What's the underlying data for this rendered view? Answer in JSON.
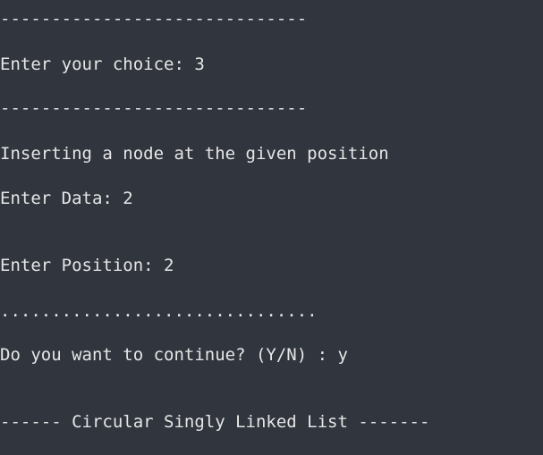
{
  "terminal": {
    "lines": [
      "------------------------------",
      "Enter your choice: 3",
      "------------------------------",
      "Inserting a node at the given position",
      "Enter Data: 2",
      "Enter Position: 2",
      "...............................",
      "Do you want to continue? (Y/N) : y",
      "------ Circular Singly Linked List -------"
    ]
  },
  "colors": {
    "background": "#30353e",
    "text": "#e6e6e6"
  }
}
